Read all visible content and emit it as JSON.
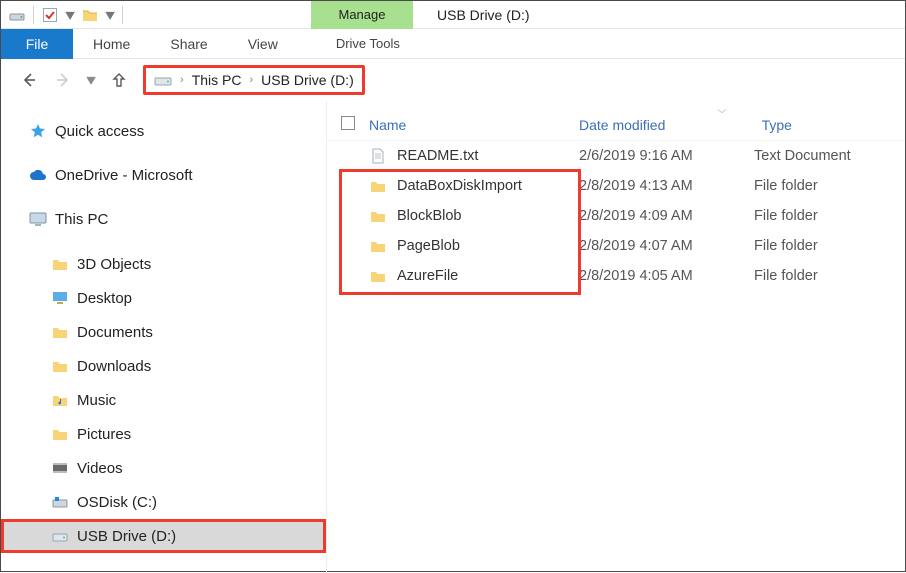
{
  "title": "USB Drive (D:)",
  "manageTab": "Manage",
  "driveTools": "Drive Tools",
  "tabs": {
    "file": "File",
    "home": "Home",
    "share": "Share",
    "view": "View"
  },
  "breadcrumb": [
    "This PC",
    "USB Drive (D:)"
  ],
  "sidebar": {
    "quickAccess": "Quick access",
    "oneDrive": "OneDrive - Microsoft",
    "thisPC": "This PC",
    "children": [
      "3D Objects",
      "Desktop",
      "Documents",
      "Downloads",
      "Music",
      "Pictures",
      "Videos",
      "OSDisk (C:)",
      "USB Drive (D:)"
    ]
  },
  "columns": {
    "name": "Name",
    "date": "Date modified",
    "type": "Type"
  },
  "rows": [
    {
      "name": "README.txt",
      "date": "2/6/2019 9:16 AM",
      "type": "Text Document",
      "icon": "file"
    },
    {
      "name": "DataBoxDiskImport",
      "date": "2/8/2019 4:13 AM",
      "type": "File folder",
      "icon": "folder"
    },
    {
      "name": "BlockBlob",
      "date": "2/8/2019 4:09 AM",
      "type": "File folder",
      "icon": "folder"
    },
    {
      "name": "PageBlob",
      "date": "2/8/2019 4:07 AM",
      "type": "File folder",
      "icon": "folder"
    },
    {
      "name": "AzureFile",
      "date": "2/8/2019 4:05 AM",
      "type": "File folder",
      "icon": "folder"
    }
  ]
}
